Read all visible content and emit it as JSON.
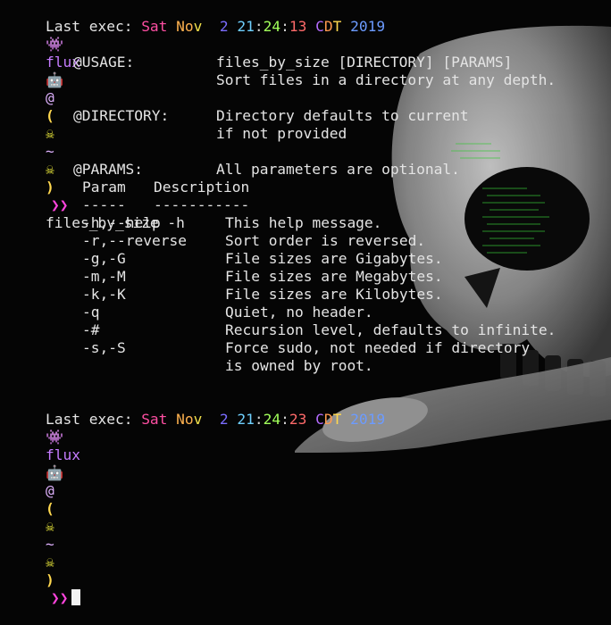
{
  "last_exec_1": {
    "prefix": "Last exec: ",
    "segments": [
      {
        "t": "Sat ",
        "c": "#ff4fa3"
      },
      {
        "t": "No",
        "c": "#ffb14f"
      },
      {
        "t": "v  ",
        "c": "#f0e04a"
      },
      {
        "t": "2 ",
        "c": "#7b6cff"
      },
      {
        "t": "21",
        "c": "#6fd0ff"
      },
      {
        "t": ":",
        "c": "#cfcfcf"
      },
      {
        "t": "24",
        "c": "#a1ff5a"
      },
      {
        "t": ":",
        "c": "#cfcfcf"
      },
      {
        "t": "13 ",
        "c": "#ff6a6a"
      },
      {
        "t": "C",
        "c": "#b46cff"
      },
      {
        "t": "D",
        "c": "#ff9b4f"
      },
      {
        "t": "T ",
        "c": "#ffd84f"
      },
      {
        "t": "2019",
        "c": "#6c9bff"
      }
    ]
  },
  "last_exec_2": {
    "prefix": "Last exec: ",
    "segments": [
      {
        "t": "Sat ",
        "c": "#ff4fa3"
      },
      {
        "t": "No",
        "c": "#ffb14f"
      },
      {
        "t": "v  ",
        "c": "#f0e04a"
      },
      {
        "t": "2 ",
        "c": "#7b6cff"
      },
      {
        "t": "21",
        "c": "#6fd0ff"
      },
      {
        "t": ":",
        "c": "#cfcfcf"
      },
      {
        "t": "24",
        "c": "#a1ff5a"
      },
      {
        "t": ":",
        "c": "#cfcfcf"
      },
      {
        "t": "23 ",
        "c": "#ff6a6a"
      },
      {
        "t": "C",
        "c": "#b46cff"
      },
      {
        "t": "D",
        "c": "#ff9b4f"
      },
      {
        "t": "T ",
        "c": "#ffd84f"
      },
      {
        "t": "2019",
        "c": "#6c9bff"
      }
    ]
  },
  "prompt": {
    "invader_glyph": "👾",
    "user": "flux",
    "robot_glyph": "🤖",
    "at": "@",
    "paren_open": "(",
    "paren_close": ")",
    "skull_glyph": "☠",
    "tilde": "~",
    "arrow": "❯❯",
    "user_color": "#c57cff",
    "arrow_color": "#ff44dd",
    "paren_color": "#ffd84f",
    "skull_color": "#e7e53a"
  },
  "command": "files_by_size -h",
  "usage": {
    "label": "@USAGE:",
    "line1": "files_by_size [DIRECTORY] [PARAMS]",
    "line2": "Sort files in a directory at any depth."
  },
  "directory": {
    "label": "@DIRECTORY:",
    "line1": "Directory defaults to current",
    "line2": "if not provided"
  },
  "params": {
    "label": "@PARAMS:",
    "line1": "All parameters are optional.",
    "col1_header": "Param",
    "col2_header": "Description",
    "col1_rule": "-----",
    "col2_rule": "-----------",
    "rows": [
      {
        "param": "-h,--help",
        "desc": "This help message."
      },
      {
        "param": "-r,--reverse",
        "desc": "Sort order is reversed."
      },
      {
        "param": "-g,-G",
        "desc": "File sizes are Gigabytes."
      },
      {
        "param": "-m,-M",
        "desc": "File sizes are Megabytes."
      },
      {
        "param": "-k,-K",
        "desc": "File sizes are Kilobytes."
      },
      {
        "param": "-q",
        "desc": "Quiet, no header."
      },
      {
        "param": "-#",
        "desc": "Recursion level, defaults to infinite."
      },
      {
        "param": "-s,-S",
        "desc": "Force sudo, not needed if directory"
      },
      {
        "param": "",
        "desc": "is owned by root."
      }
    ]
  }
}
